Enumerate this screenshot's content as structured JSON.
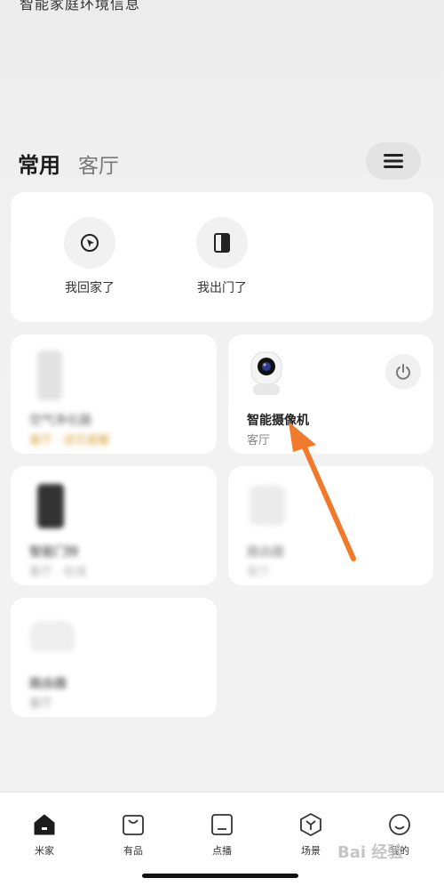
{
  "header": {
    "top_text": "智能家庭环境信息"
  },
  "tabs": [
    {
      "label": "常用"
    },
    {
      "label": "客厅"
    }
  ],
  "scenes": [
    {
      "label": "我回家了"
    },
    {
      "label": "我出门了"
    }
  ],
  "devices": [
    {
      "name": "空气净化器",
      "room": "客厅 · 滤芯提醒"
    },
    {
      "name": "智能摄像机",
      "room": "客厅"
    },
    {
      "name": "智能门铃",
      "room": "客厅 · 在线"
    },
    {
      "name": "路由器",
      "room": "客厅"
    },
    {
      "name": "路由器",
      "room": "客厅"
    }
  ],
  "nav": [
    {
      "label": "米家",
      "icon": "home-icon",
      "active": true
    },
    {
      "label": "有品",
      "icon": "shopping-bag-icon"
    },
    {
      "label": "点播",
      "icon": "tv-icon"
    },
    {
      "label": "场景",
      "icon": "scene-box-icon"
    },
    {
      "label": "我的",
      "icon": "profile-smile-icon"
    }
  ],
  "watermark": "Bai 经验",
  "colors": {
    "accent_arrow": "#f07a2c",
    "active_nav": "#1c1c1c"
  }
}
